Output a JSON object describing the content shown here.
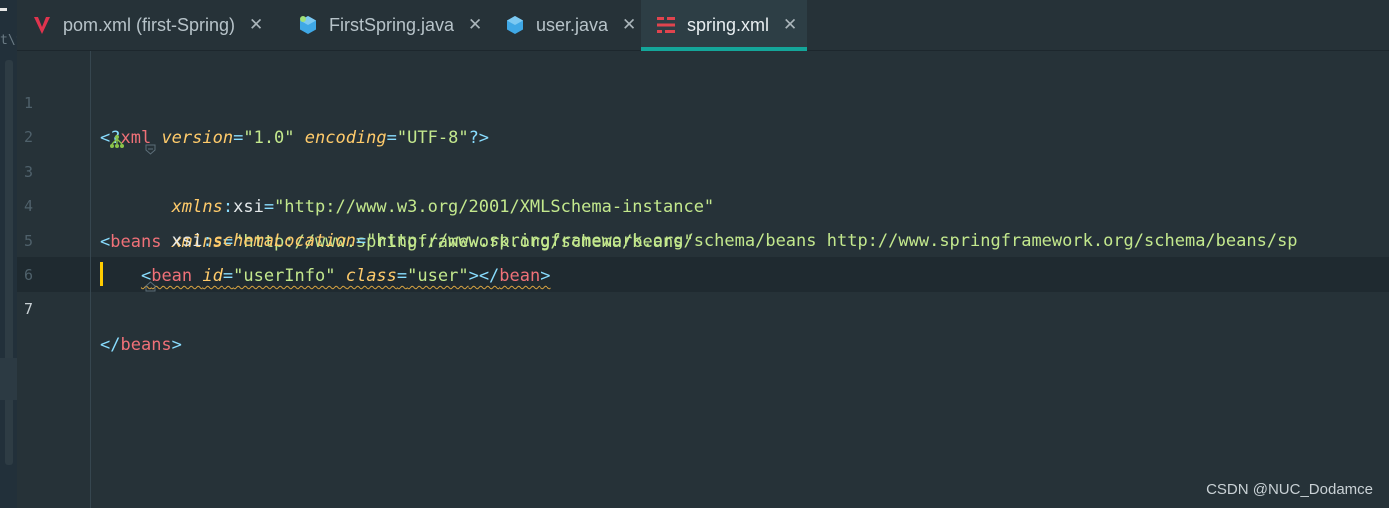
{
  "sidebar": {
    "fragment": "t\\f"
  },
  "tabs": [
    {
      "label": "pom.xml (first-Spring)",
      "icon": "maven-icon",
      "active": false
    },
    {
      "label": "FirstSpring.java",
      "icon": "java-class-icon",
      "active": false
    },
    {
      "label": "user.java",
      "icon": "java-class-icon",
      "active": false
    },
    {
      "label": "spring.xml",
      "icon": "spring-xml-icon",
      "active": true
    }
  ],
  "close_glyph": "✕",
  "editor": {
    "line_numbers": [
      "1",
      "2",
      "3",
      "4",
      "5",
      "6",
      "7"
    ],
    "current_line": "7",
    "lines": [
      [
        [
          "punc",
          "<?"
        ],
        [
          "tag",
          "xml "
        ],
        [
          "attr",
          "version"
        ],
        [
          "punc",
          "="
        ],
        [
          "str",
          "\"1.0\" "
        ],
        [
          "attr",
          "encoding"
        ],
        [
          "punc",
          "="
        ],
        [
          "str",
          "\"UTF-8\""
        ],
        [
          "punc",
          "?>"
        ]
      ],
      [
        [
          "punc",
          "<"
        ],
        [
          "tag",
          "beans "
        ],
        [
          "attr",
          "xmlns"
        ],
        [
          "punc",
          "="
        ],
        [
          "str",
          "\"http://www.springframework.org/schema/beans\""
        ]
      ],
      [
        [
          "plain",
          "       "
        ],
        [
          "attr",
          "xmlns"
        ],
        [
          "punc",
          ":"
        ],
        [
          "plain",
          "xsi"
        ],
        [
          "punc",
          "="
        ],
        [
          "str",
          "\"http://www.w3.org/2001/XMLSchema-instance\""
        ]
      ],
      [
        [
          "plain",
          "       "
        ],
        [
          "plain",
          "xsi"
        ],
        [
          "punc",
          ":"
        ],
        [
          "attr",
          "schemaLocation"
        ],
        [
          "punc",
          "="
        ],
        [
          "str",
          "\"http://www.springframework.org/schema/beans http://www.springframework.org/schema/beans/sp"
        ]
      ],
      [
        [
          "plain",
          "    "
        ],
        [
          "punc",
          "<"
        ],
        [
          "tag",
          "bean "
        ],
        [
          "attr",
          "id"
        ],
        [
          "punc",
          "="
        ],
        [
          "str",
          "\"userInfo\" "
        ],
        [
          "attr",
          "class"
        ],
        [
          "punc",
          "="
        ],
        [
          "str",
          "\"user\""
        ],
        [
          "punc",
          "></"
        ],
        [
          "tag",
          "bean"
        ],
        [
          "punc",
          ">"
        ]
      ],
      [
        [
          "punc",
          "</"
        ],
        [
          "tag",
          "beans"
        ],
        [
          "punc",
          ">"
        ]
      ],
      []
    ]
  },
  "watermark": "CSDN @NUC_Dodamce",
  "colors": {
    "accent": "#14a69a",
    "caret": "#ffcc00",
    "tag": "#f07178",
    "attr": "#ffcb6b",
    "string": "#c3e88d"
  }
}
